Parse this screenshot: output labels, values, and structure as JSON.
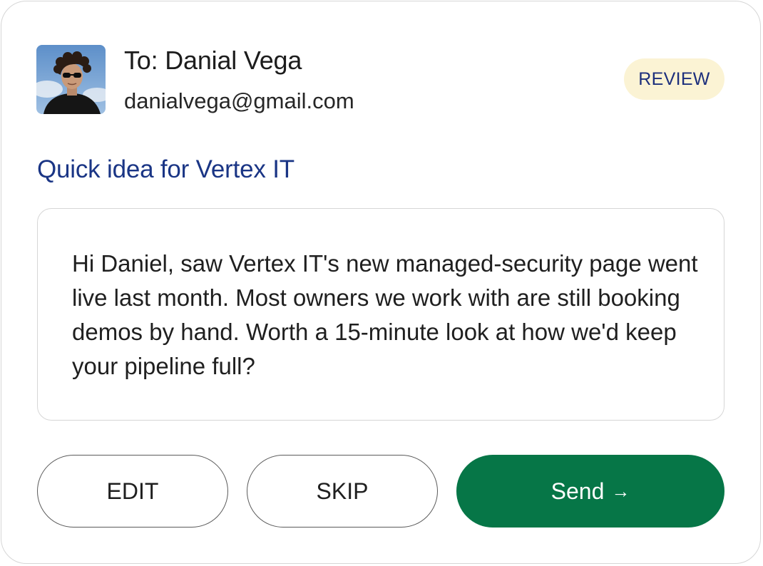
{
  "recipient": {
    "name_line": "To: Danial Vega",
    "email": "danialvega@gmail.com",
    "avatar": "profile-photo"
  },
  "status": {
    "label": "REVIEW",
    "bg_color": "#fbf3d4",
    "text_color": "#1d2f7c"
  },
  "email": {
    "subject": "Quick idea for Vertex IT",
    "body": "Hi Daniel, saw Vertex IT's new managed-security page went live last month. Most owners we work with are still booking demos by hand. Worth a 15-minute look at how we'd keep your pipeline full?"
  },
  "actions": {
    "edit_label": "EDIT",
    "skip_label": "SKIP",
    "send_label": "Send",
    "send_icon": "arrow-right-icon",
    "send_color": "#067647"
  },
  "colors": {
    "subject": "#1a3585",
    "border": "#d6d6d6"
  }
}
